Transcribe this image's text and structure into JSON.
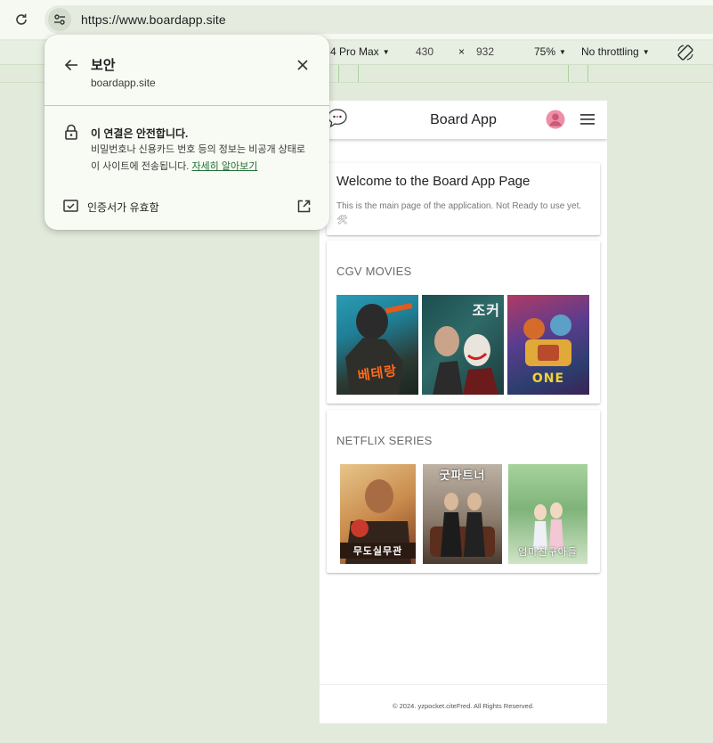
{
  "browser": {
    "url": "https://www.boardapp.site"
  },
  "devtools": {
    "device": "4 Pro Max",
    "width": "430",
    "times": "×",
    "height": "932",
    "zoom": "75%",
    "throttling": "No throttling"
  },
  "popup": {
    "title": "보안",
    "domain": "boardapp.site",
    "secure_title": "이 연결은 안전합니다.",
    "secure_desc": "비밀번호나 신용카드 번호 등의 정보는 비공개 상태로 이 사이트에 전송됩니다. ",
    "learn_more": "자세히 알아보기",
    "cert_label": "인증서가 유효함"
  },
  "app": {
    "title": "Board App",
    "welcome_title": "Welcome to the Board App Page",
    "welcome_text": "This is the main page of the application. Not Ready to use yet. 🛠",
    "movies_title": "CGV MOVIES",
    "series_title": "NETFLIX SERIES",
    "footer": "© 2024. yzpocket.citeFred. All Rights Reserved."
  },
  "posters": {
    "movie1": "베테랑",
    "movie2": "조커",
    "movie3": "ONE",
    "series1": "무도실무관",
    "series2": "굿파트너",
    "series3": "엄마친구아들"
  },
  "colors": {
    "accent": "#236d3a",
    "avatar": "#ee8fa8",
    "chrome_bg": "#f6f9f1"
  }
}
